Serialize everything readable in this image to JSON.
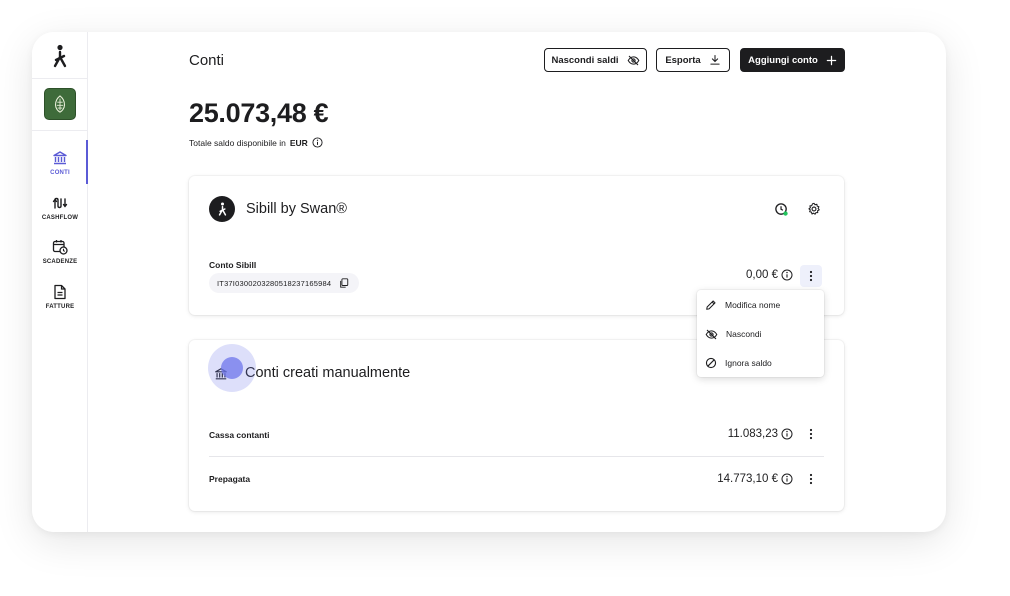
{
  "sidebar": {
    "logo_icon": "sibill-logo-icon",
    "org_avatar_icon": "emblem-icon",
    "items": [
      {
        "label": "CONTI",
        "icon": "bank-icon",
        "active": true
      },
      {
        "label": "CASHFLOW",
        "icon": "cashflow-icon",
        "active": false
      },
      {
        "label": "SCADENZE",
        "icon": "calendar-clock-icon",
        "active": false
      },
      {
        "label": "FATTURE",
        "icon": "invoice-icon",
        "active": false
      }
    ]
  },
  "header": {
    "title": "Conti",
    "hide_balances_label": "Nascondi saldi",
    "export_label": "Esporta",
    "add_account_label": "Aggiungi conto"
  },
  "summary": {
    "total": "25.073,48 €",
    "caption_prefix": "Totale saldo disponibile in",
    "currency": "EUR"
  },
  "bank_card": {
    "title": "Sibill by Swan®",
    "status_dot_color": "#22c55e",
    "account": {
      "name": "Conto Sibill",
      "iban": "IT37I0300203280518237165984",
      "balance": "0,00 €"
    }
  },
  "context_menu": {
    "items": [
      {
        "label": "Modifica nome",
        "icon": "pencil-icon"
      },
      {
        "label": "Nascondi",
        "icon": "eye-off-icon"
      },
      {
        "label": "Ignora saldo",
        "icon": "ban-icon"
      }
    ]
  },
  "manual_card": {
    "title": "Conti creati manualmente",
    "accounts": [
      {
        "name": "Cassa contanti",
        "balance": "11.083,23"
      },
      {
        "name": "Prepagata",
        "balance": "14.773,10 €"
      }
    ]
  },
  "colors": {
    "accent": "#5b5bd6",
    "dark": "#1d1d1f",
    "org_avatar": "#3e6b3a"
  }
}
